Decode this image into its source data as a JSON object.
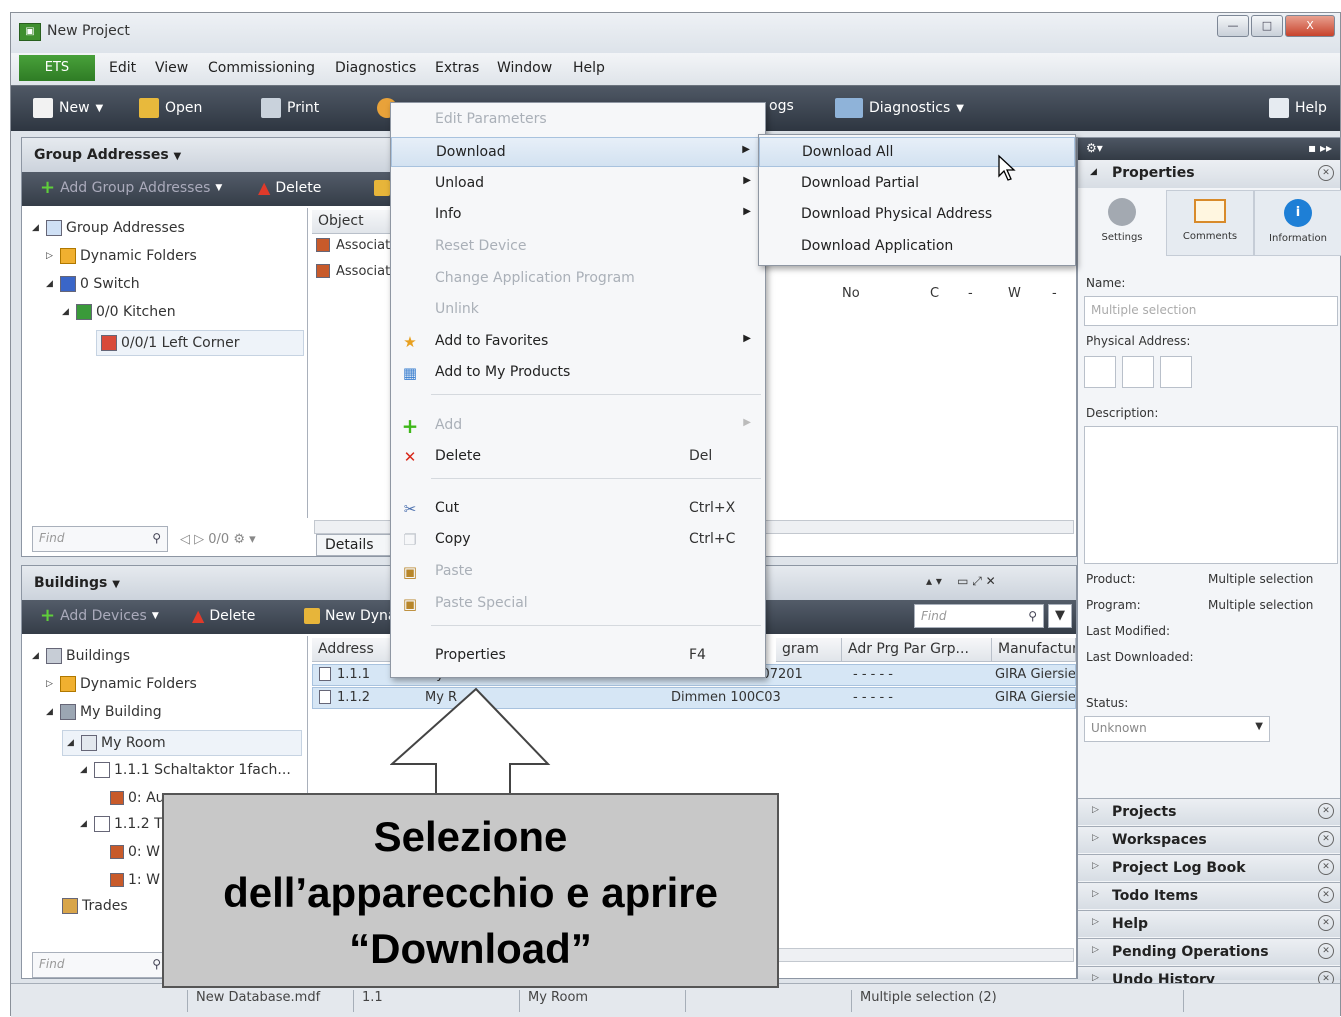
{
  "window": {
    "title": "New Project",
    "controls": [
      "—",
      "□",
      "X"
    ]
  },
  "menubar": {
    "items": [
      "ETS",
      "Edit",
      "View",
      "Commissioning",
      "Diagnostics",
      "Extras",
      "Window",
      "Help"
    ]
  },
  "toolbar": {
    "new": "New",
    "open": "Open",
    "print": "Print",
    "logs": "ogs",
    "diagnostics": "Diagnostics",
    "help": "Help"
  },
  "group_panel": {
    "title": "Group Addresses",
    "add_button": "Add Group Addresses",
    "delete_button": "Delete",
    "tree": [
      "Group Addresses",
      "Dynamic Folders",
      "0 Switch",
      "0/0 Kitchen",
      "0/0/1 Left Corner"
    ],
    "column_object": "Object",
    "rows": [
      "Associat",
      "Associat"
    ],
    "row_values": [
      "No",
      "C",
      "-",
      "W",
      "-"
    ],
    "find_placeholder": "Find",
    "nav_count": "0/0",
    "details_tab": "Details"
  },
  "buildings_panel": {
    "title": "Buildings",
    "add_button": "Add Devices",
    "delete_button": "Delete",
    "new_dyn": "New Dyna",
    "find_placeholder": "Find",
    "tree": [
      "Buildings",
      "Dynamic Folders",
      "My Building",
      "My Room",
      "1.1.1 Schaltaktor 1fach...",
      "0: Au",
      "1.1.2 T",
      "0: W",
      "1: W",
      "Trades"
    ],
    "columns": [
      "Address",
      "gram",
      "Adr Prg Par Grp...",
      "Manufactur"
    ],
    "rows": [
      {
        "address": "1.1.1",
        "room": "My Room",
        "program": "Schalten UP 207201",
        "flags": "-   -   -   -   -",
        "manufacturer": "GIRA Giersie"
      },
      {
        "address": "1.1.2",
        "room": "My R",
        "program": "Dimmen 100C03",
        "flags": "-   -   -   -   -",
        "manufacturer": "GIRA Giersie"
      }
    ]
  },
  "context_menu": {
    "items": [
      {
        "label": "Edit Parameters",
        "disabled": true
      },
      {
        "label": "Download",
        "submenu": true,
        "highlight": true
      },
      {
        "label": "Unload",
        "submenu": true
      },
      {
        "label": "Info",
        "submenu": true
      },
      {
        "label": "Reset Device",
        "disabled": true
      },
      {
        "label": "Change Application Program",
        "disabled": true
      },
      {
        "label": "Unlink",
        "disabled": true
      },
      {
        "label": "Add to Favorites",
        "submenu": true
      },
      {
        "label": "Add to My Products"
      },
      {
        "label": "Add",
        "disabled": true,
        "submenu": true
      },
      {
        "label": "Delete",
        "shortcut": "Del"
      },
      {
        "label": "Cut",
        "shortcut": "Ctrl+X"
      },
      {
        "label": "Copy",
        "shortcut": "Ctrl+C"
      },
      {
        "label": "Paste",
        "disabled": true
      },
      {
        "label": "Paste Special",
        "disabled": true
      },
      {
        "label": "Properties",
        "shortcut": "F4"
      }
    ]
  },
  "download_submenu": {
    "items": [
      "Download All",
      "Download Partial",
      "Download Physical Address",
      "Download Application"
    ]
  },
  "properties_panel": {
    "title": "Properties",
    "tabs": [
      "Settings",
      "Comments",
      "Information"
    ],
    "name_label": "Name:",
    "name_placeholder": "Multiple selection",
    "physical_address_label": "Physical Address:",
    "description_label": "Description:",
    "product_label": "Product:",
    "product_value": "Multiple selection",
    "program_label": "Program:",
    "program_value": "Multiple selection",
    "last_modified_label": "Last Modified:",
    "last_downloaded_label": "Last Downloaded:",
    "status_label": "Status:",
    "status_value": "Unknown",
    "sections": [
      "Projects",
      "Workspaces",
      "Project Log Book",
      "Todo Items",
      "Help",
      "Pending Operations",
      "Undo History"
    ]
  },
  "statusbar": {
    "database": "New Database.mdf",
    "address": "1.1",
    "room": "My Room",
    "selection": "Multiple selection (2)"
  },
  "callout": {
    "text": "Selezione\ndell’apparecchio e aprire\n“Download”"
  },
  "colors": {
    "ets_green": "#3a8e2e",
    "toolbar_dark": "#3a424d",
    "selection_blue": "#d6e6f5",
    "callout_gray": "#c8c8c8"
  }
}
